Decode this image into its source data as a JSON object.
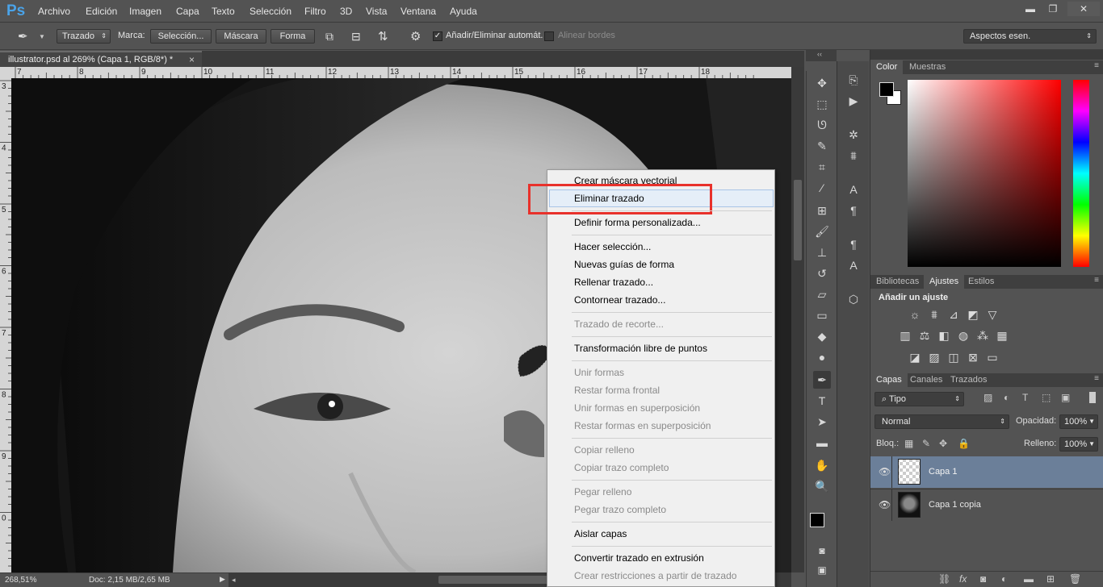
{
  "menubar": {
    "logo": "Ps",
    "items": [
      "Archivo",
      "Edición",
      "Imagen",
      "Capa",
      "Texto",
      "Selección",
      "Filtro",
      "3D",
      "Vista",
      "Ventana",
      "Ayuda"
    ],
    "min": "▬",
    "max": "❐",
    "close": "✕"
  },
  "options": {
    "mode": "Trazado",
    "marca": "Marca:",
    "seleccion": "Selección...",
    "mascara": "Máscara",
    "forma": "Forma",
    "autoadd": "Añadir/Eliminar automát.",
    "alinear": "Alinear bordes",
    "workspace": "Aspectos esen."
  },
  "document": {
    "tab": "illustrator.psd al 269% (Capa 1, RGB/8*) *",
    "close": "×",
    "hruler": [
      "7",
      "8",
      "9",
      "10",
      "11",
      "12",
      "13",
      "14",
      "15",
      "16",
      "17",
      "18"
    ],
    "vruler": [
      "3",
      "4",
      "5",
      "6",
      "7",
      "8",
      "9",
      "0"
    ]
  },
  "status": {
    "zoom": "268,51%",
    "doc": "Doc: 2,15 MB/2,65 MB"
  },
  "context_menu": {
    "items": [
      {
        "label": "Crear máscara vectorial",
        "enabled": true
      },
      {
        "label": "Eliminar trazado",
        "enabled": true,
        "highlighted": true
      },
      {
        "label": "Definir forma personalizada...",
        "enabled": true
      },
      {
        "label": "Hacer selección...",
        "enabled": true
      },
      {
        "label": "Nuevas guías de forma",
        "enabled": true
      },
      {
        "label": "Rellenar trazado...",
        "enabled": true
      },
      {
        "label": "Contornear trazado...",
        "enabled": true
      },
      {
        "label": "Trazado de recorte...",
        "enabled": false
      },
      {
        "label": "Transformación libre de puntos",
        "enabled": true
      },
      {
        "label": "Unir formas",
        "enabled": false
      },
      {
        "label": "Restar forma frontal",
        "enabled": false
      },
      {
        "label": "Unir formas en superposición",
        "enabled": false
      },
      {
        "label": "Restar formas en superposición",
        "enabled": false
      },
      {
        "label": "Copiar relleno",
        "enabled": false
      },
      {
        "label": "Copiar trazo completo",
        "enabled": false
      },
      {
        "label": "Pegar relleno",
        "enabled": false
      },
      {
        "label": "Pegar trazo completo",
        "enabled": false
      },
      {
        "label": "Aislar capas",
        "enabled": true
      },
      {
        "label": "Convertir trazado en extrusión",
        "enabled": true
      },
      {
        "label": "Crear restricciones a partir de trazado",
        "enabled": false
      }
    ]
  },
  "panels": {
    "color_tabs": [
      "Color",
      "Muestras"
    ],
    "adj_tabs": [
      "Bibliotecas",
      "Ajustes",
      "Estilos"
    ],
    "adj_title": "Añadir un ajuste",
    "layers_tabs": [
      "Capas",
      "Canales",
      "Trazados"
    ],
    "filter": "Tipo",
    "blend": "Normal",
    "opacity_label": "Opacidad:",
    "opacity": "100%",
    "lock_label": "Bloq.:",
    "fill_label": "Relleno:",
    "fill": "100%",
    "layers": [
      {
        "name": "Capa 1",
        "selected": true
      },
      {
        "name": "Capa 1 copia",
        "selected": false
      }
    ]
  },
  "colors": {
    "accent": "#e8312b",
    "selected_layer": "#6b7f99",
    "ps_blue": "#4aa3e8"
  }
}
